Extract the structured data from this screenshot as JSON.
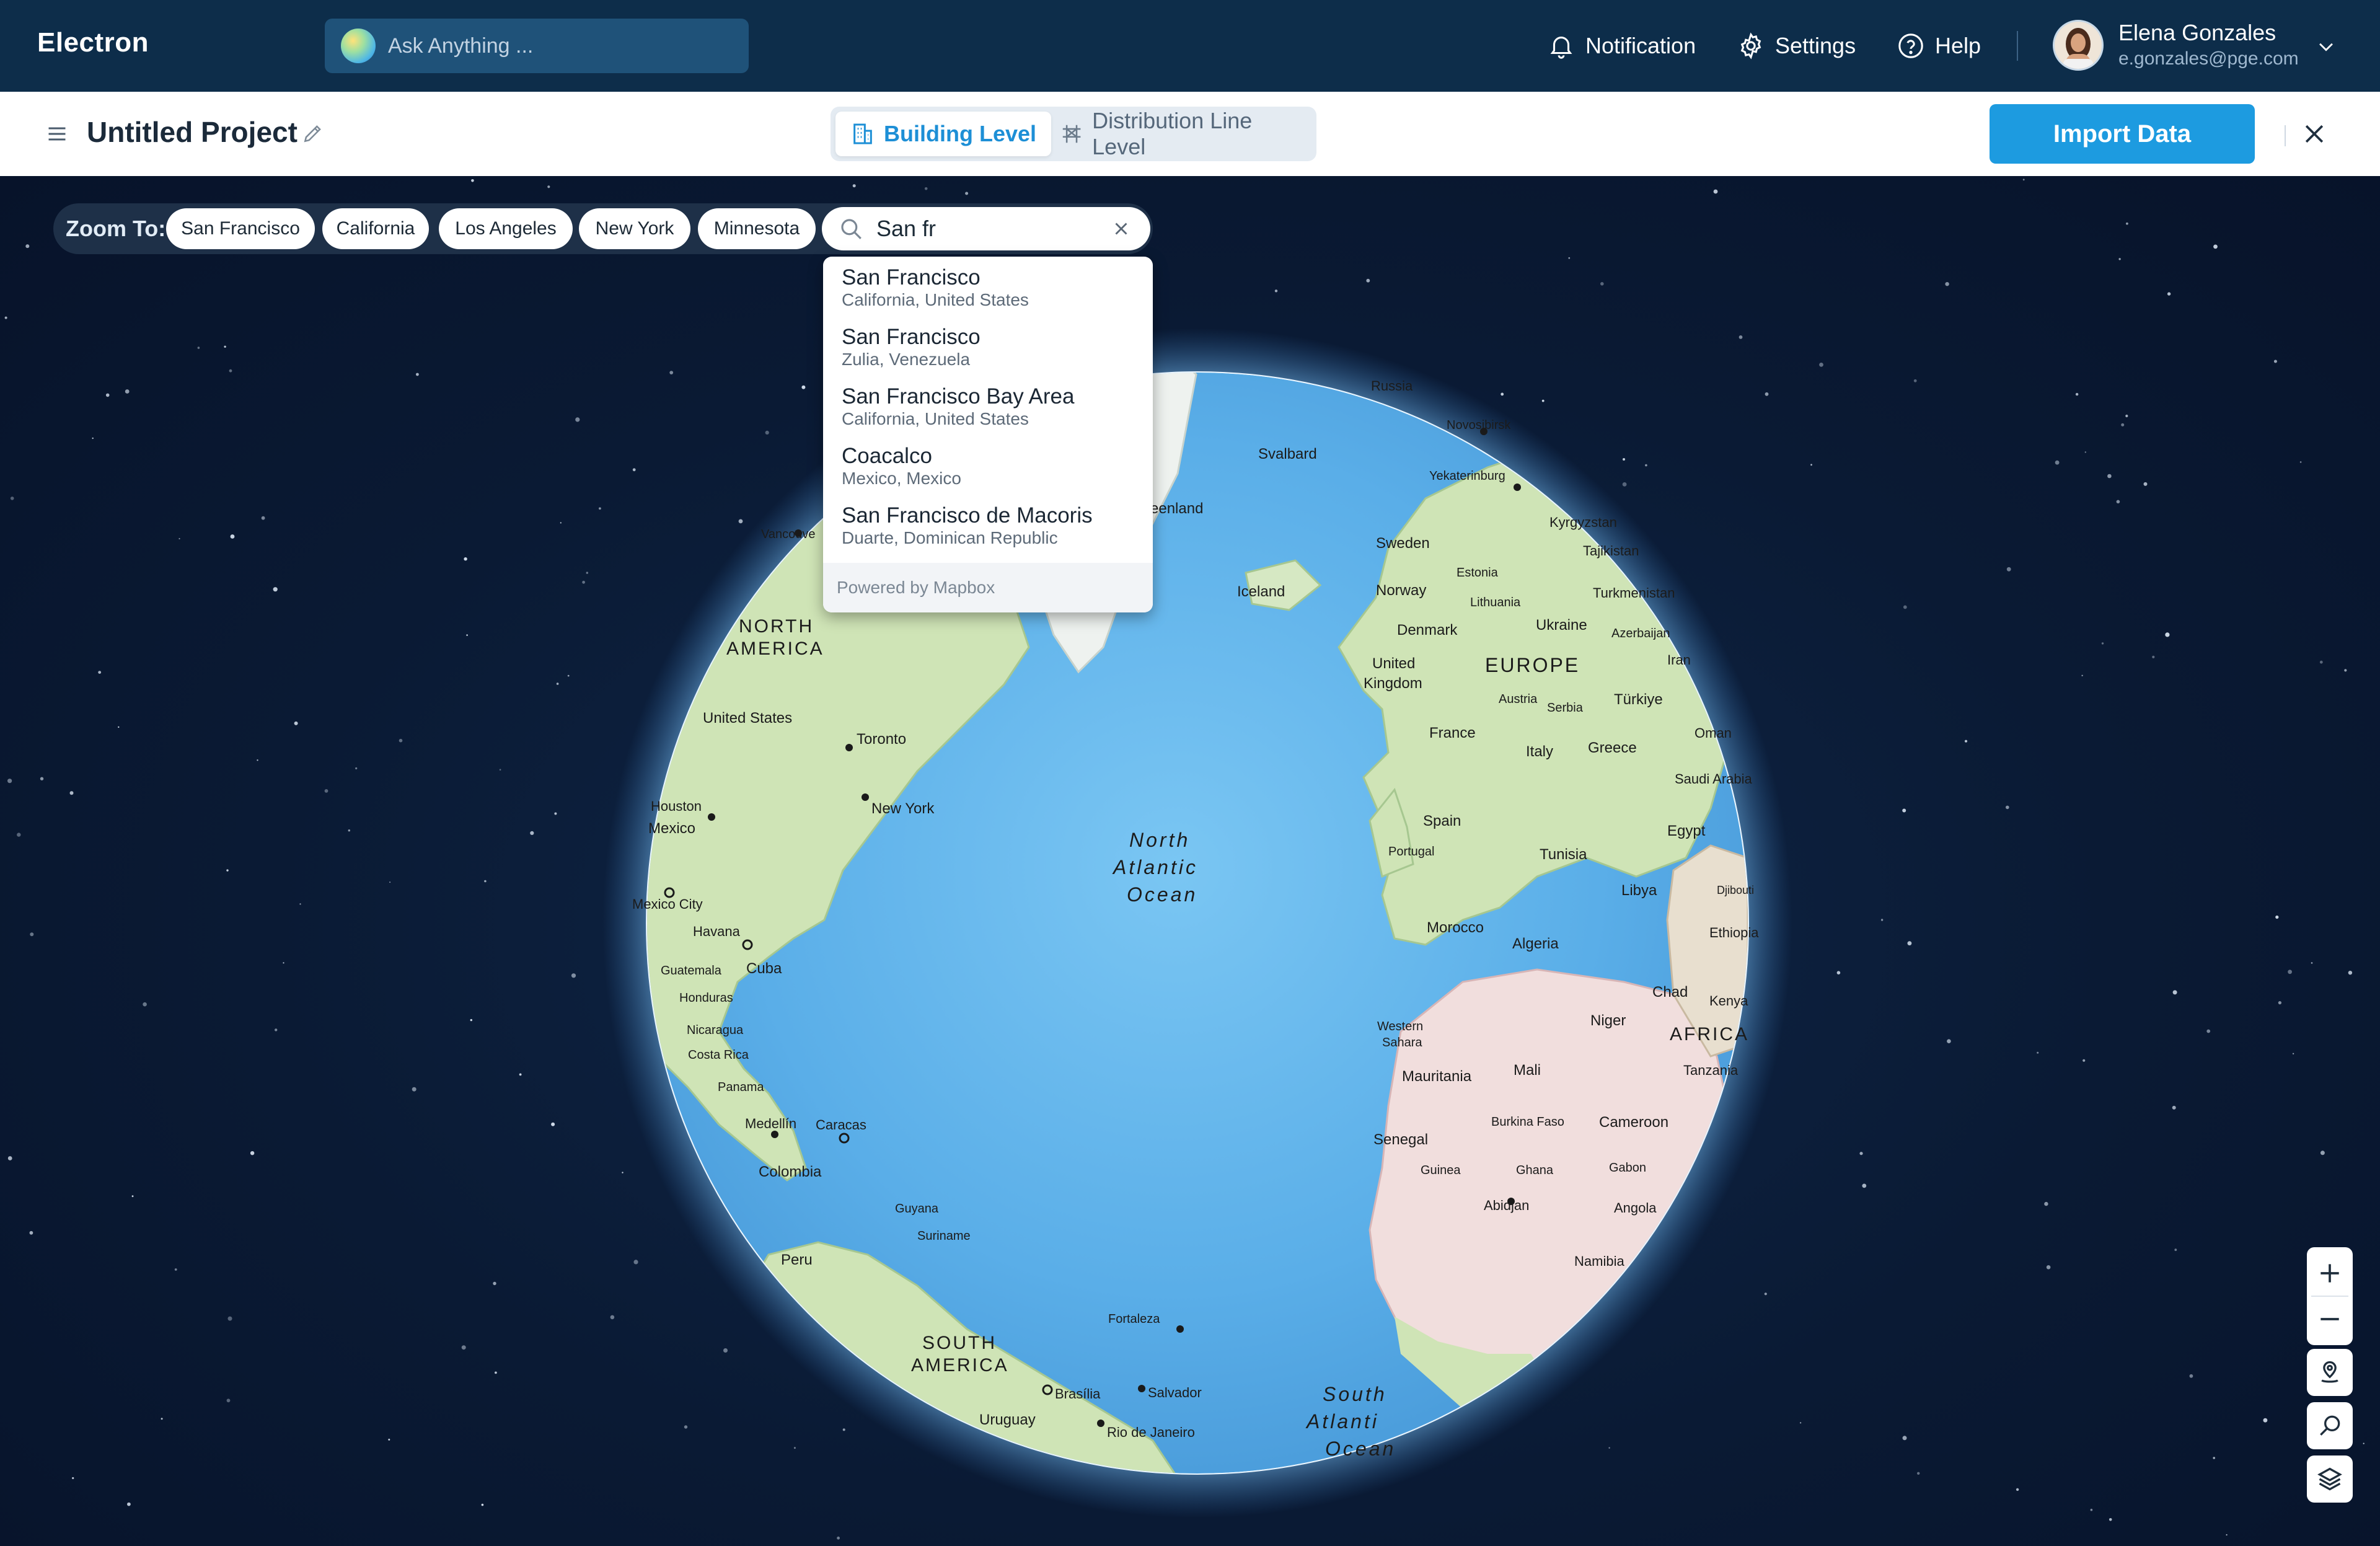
{
  "app": {
    "name": "Electron"
  },
  "ask": {
    "placeholder": "Ask Anything ..."
  },
  "topnav": {
    "notification": "Notification",
    "settings": "Settings",
    "help": "Help"
  },
  "user": {
    "name": "Elena Gonzales",
    "email": "e.gonzales@pge.com"
  },
  "project": {
    "title": "Untitled Project"
  },
  "levels": {
    "building": "Building Level",
    "distribution": "Distribution Line Level",
    "active": "building"
  },
  "actions": {
    "import": "Import Data"
  },
  "zoom": {
    "label": "Zoom To:",
    "chips": [
      "San Francisco",
      "California",
      "Los Angeles",
      "New York",
      "Minnesota"
    ]
  },
  "search": {
    "value": "San fr",
    "results": [
      {
        "title": "San Francisco",
        "subtitle": "California, United States"
      },
      {
        "title": "San Francisco",
        "subtitle": "Zulia, Venezuela"
      },
      {
        "title": "San Francisco Bay Area",
        "subtitle": "California, United States"
      },
      {
        "title": "Coacalco",
        "subtitle": "Mexico, Mexico"
      },
      {
        "title": "San Francisco de Macoris",
        "subtitle": "Duarte, Dominican Republic"
      }
    ],
    "footer": "Powered by Mapbox"
  },
  "map": {
    "labels": {
      "russia": "Russia",
      "novosibirsk": "Novosibirsk",
      "svalbard": "Svalbard",
      "yekaterinburg": "Yekaterinburg",
      "greenland": "eenland",
      "vancouver": "Vancouve",
      "kyrgyzstan": "Kyrgyzstan",
      "tajikistan": "Tajikistan",
      "sweden": "Sweden",
      "estonia": "Estonia",
      "turkmenistan": "Turkmenistan",
      "iceland": "Iceland",
      "norway": "Norway",
      "lithuania": "Lithuania",
      "north_america_1": "NORTH",
      "north_america_2": "AMERICA",
      "denmark": "Denmark",
      "ukraine": "Ukraine",
      "azerbaijan": "Azerbaijan",
      "iran": "Iran",
      "united_kingdom_1": "United",
      "united_kingdom_2": "Kingdom",
      "europe": "EUROPE",
      "austria": "Austria",
      "serbia": "Serbia",
      "turkiye": "Türkiye",
      "united_states": "United States",
      "toronto": "Toronto",
      "france": "France",
      "italy": "Italy",
      "greece": "Greece",
      "oman": "Oman",
      "houston": "Houston",
      "new_york": "New York",
      "saudi_arabia": "Saudi Arabia",
      "mexico": "Mexico",
      "spain": "Spain",
      "egypt": "Egypt",
      "portugal": "Portugal",
      "north_atlantic_1": "North",
      "north_atlantic_2": "Atlantic",
      "north_atlantic_3": "Ocean",
      "tunisia": "Tunisia",
      "mexico_city": "Mexico City",
      "libya": "Libya",
      "djibouti": "Djibouti",
      "havana": "Havana",
      "morocco": "Morocco",
      "ethiopia": "Ethiopia",
      "guatemala": "Guatemala",
      "cuba": "Cuba",
      "algeria": "Algeria",
      "honduras": "Honduras",
      "chad": "Chad",
      "kenya": "Kenya",
      "western_sahara_1": "Western",
      "western_sahara_2": "Sahara",
      "niger": "Niger",
      "nicaragua": "Nicaragua",
      "africa": "AFRICA",
      "costa_rica": "Costa Rica",
      "mauritania": "Mauritania",
      "mali": "Mali",
      "tanzania": "Tanzania",
      "panama": "Panama",
      "burkina_faso": "Burkina Faso",
      "cameroon": "Cameroon",
      "medellin": "Medellín",
      "caracas": "Caracas",
      "senegal": "Senegal",
      "colombia": "Colombia",
      "guinea": "Guinea",
      "ghana": "Ghana",
      "gabon": "Gabon",
      "abidjan": "Abidjan",
      "angola": "Angola",
      "guyana": "Guyana",
      "suriname": "Suriname",
      "peru": "Peru",
      "namibia": "Namibia",
      "fortaleza": "Fortaleza",
      "south_america_1": "SOUTH",
      "south_america_2": "AMERICA",
      "south_atlantic_1": "South",
      "south_atlantic_2": "Atlanti",
      "south_atlantic_3": "Ocean",
      "brasilia": "Brasília",
      "salvador": "Salvador",
      "uruguay": "Uruguay",
      "rio": "Rio de Janeiro"
    }
  },
  "icons": {
    "notification": "bell-icon",
    "settings": "gear-icon",
    "help": "help-circle-icon",
    "menu": "hamburger-icon",
    "edit": "pencil-icon",
    "building": "building-icon",
    "distribution": "power-line-icon",
    "close": "close-icon",
    "search": "search-icon",
    "zoom_in": "plus-icon",
    "zoom_out": "minus-icon",
    "locate": "location-pin-icon",
    "geocode": "magnify-icon",
    "layers": "layers-icon"
  },
  "colors": {
    "topbar": "#0d2d4a",
    "accent": "#1d9be0",
    "ocean": "#5fb3ea",
    "land": "#cfe6b8"
  }
}
